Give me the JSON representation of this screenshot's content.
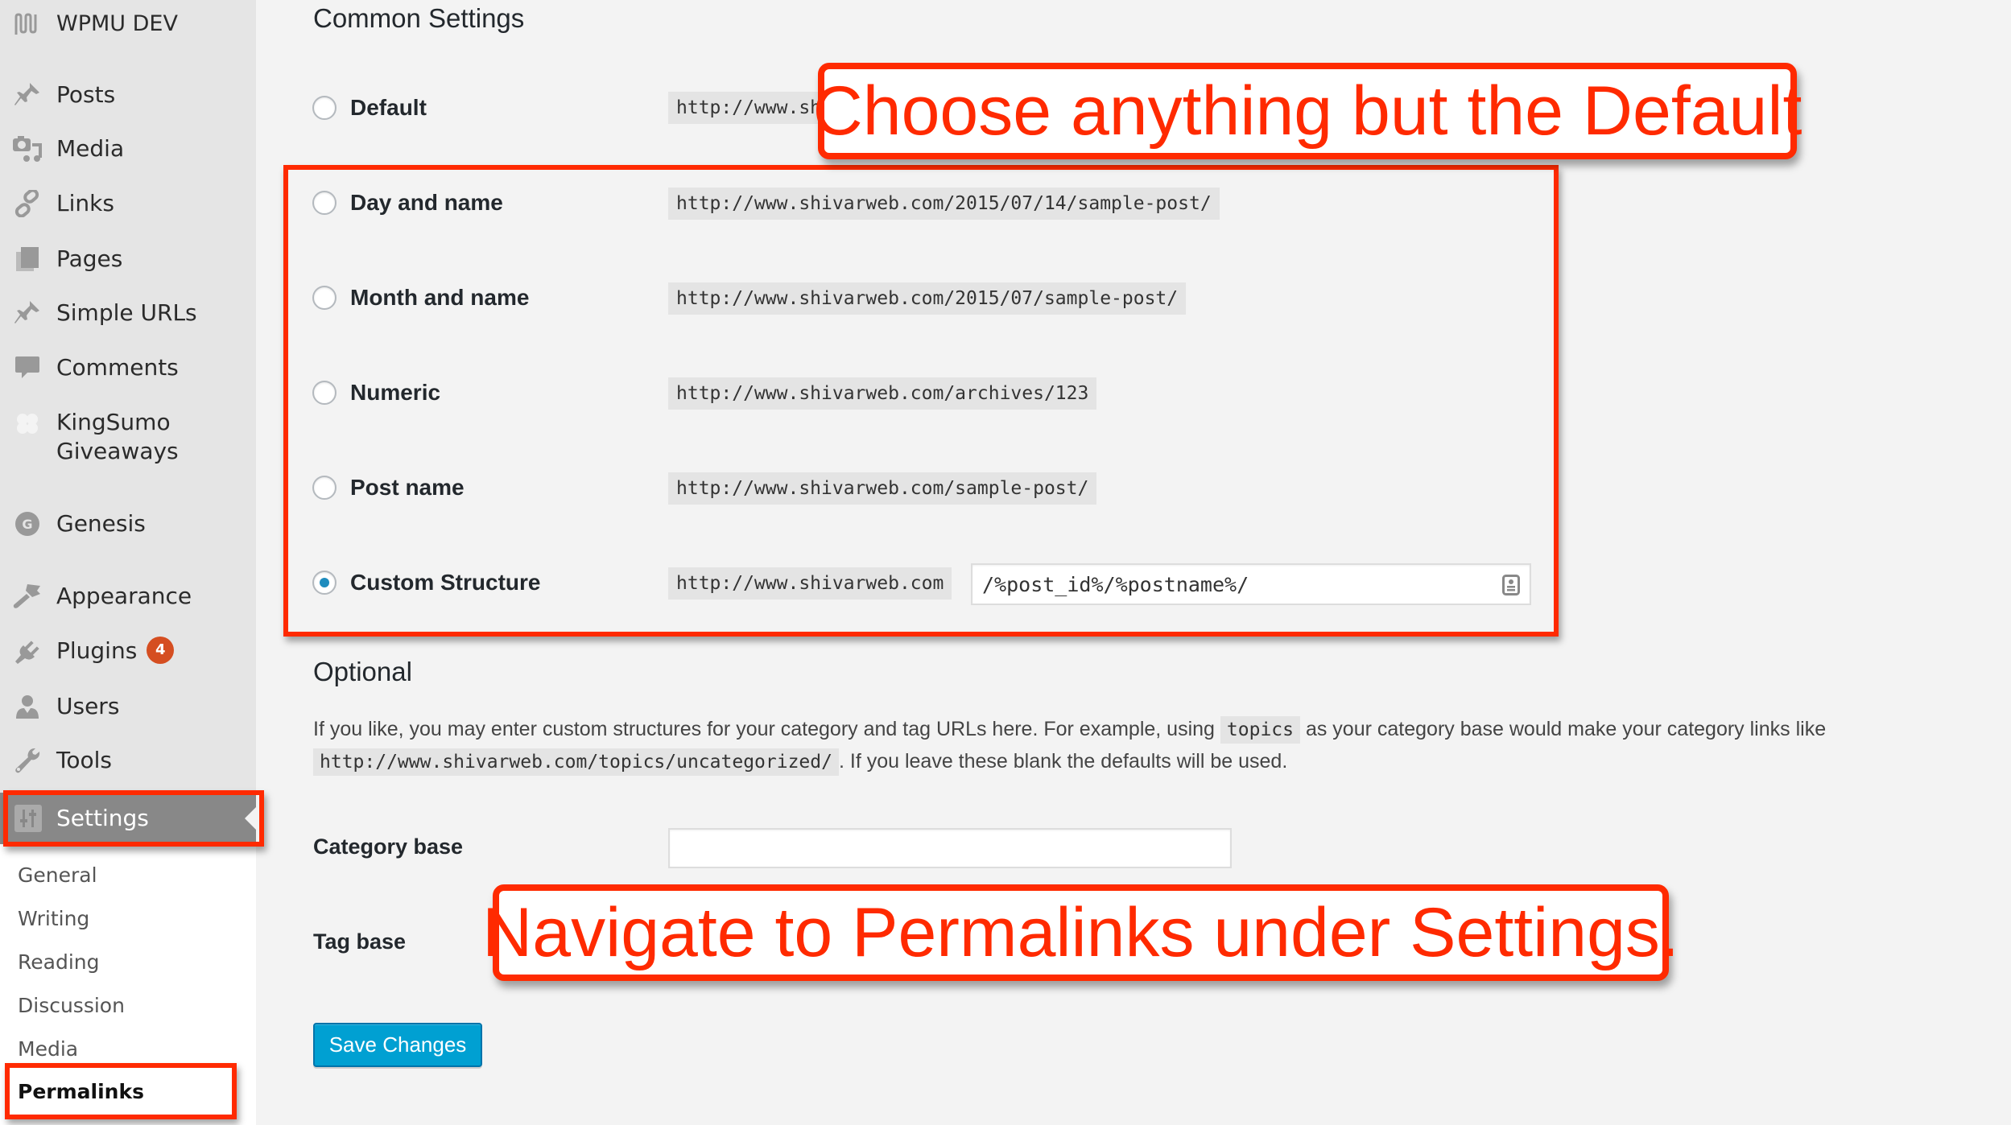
{
  "sidebar": {
    "brand": "WPMU DEV",
    "items": [
      {
        "label": "Posts",
        "icon": "pin-icon"
      },
      {
        "label": "Media",
        "icon": "media-icon"
      },
      {
        "label": "Links",
        "icon": "link-icon"
      },
      {
        "label": "Pages",
        "icon": "pages-icon"
      },
      {
        "label": "Simple URLs",
        "icon": "pin-icon"
      },
      {
        "label": "Comments",
        "icon": "comment-icon"
      },
      {
        "label": "KingSumo Giveaways",
        "icon": "clover-icon"
      },
      {
        "label": "Genesis",
        "icon": "genesis-icon"
      },
      {
        "label": "Appearance",
        "icon": "paintbrush-icon"
      },
      {
        "label": "Plugins",
        "icon": "plugin-icon",
        "badge": "4"
      },
      {
        "label": "Users",
        "icon": "user-icon"
      },
      {
        "label": "Tools",
        "icon": "wrench-icon"
      },
      {
        "label": "Settings",
        "icon": "settings-icon",
        "active": true
      }
    ],
    "submenu": [
      {
        "label": "General"
      },
      {
        "label": "Writing"
      },
      {
        "label": "Reading"
      },
      {
        "label": "Discussion"
      },
      {
        "label": "Media"
      },
      {
        "label": "Permalinks",
        "current": true
      }
    ]
  },
  "main": {
    "common_settings_title": "Common Settings",
    "options": [
      {
        "label": "Default",
        "url": "http://www.shivarweb.com/?p=123",
        "checked": false
      },
      {
        "label": "Day and name",
        "url": "http://www.shivarweb.com/2015/07/14/sample-post/",
        "checked": false
      },
      {
        "label": "Month and name",
        "url": "http://www.shivarweb.com/2015/07/sample-post/",
        "checked": false
      },
      {
        "label": "Numeric",
        "url": "http://www.shivarweb.com/archives/123",
        "checked": false
      },
      {
        "label": "Post name",
        "url": "http://www.shivarweb.com/sample-post/",
        "checked": false
      },
      {
        "label": "Custom Structure",
        "url": "http://www.shivarweb.com",
        "checked": true
      }
    ],
    "custom_structure_value": "/%post_id%/%postname%/",
    "optional_title": "Optional",
    "optional_text_1a": "If you like, you may enter custom structures for your category and tag URLs here. For example, using",
    "optional_code_1": "topics",
    "optional_text_1b": "as your category base would make your category links like",
    "optional_code_2": "http://www.shivarweb.com/topics/uncategorized/",
    "optional_text_2": ". If you leave these blank the defaults will be used.",
    "category_base_label": "Category base",
    "category_base_value": "",
    "tag_base_label": "Tag base",
    "save_button": "Save Changes"
  },
  "annotations": {
    "callout_top": "Choose anything but the Default",
    "callout_bottom": "Navigate to Permalinks under Settings.",
    "color": "#ff2a00"
  }
}
